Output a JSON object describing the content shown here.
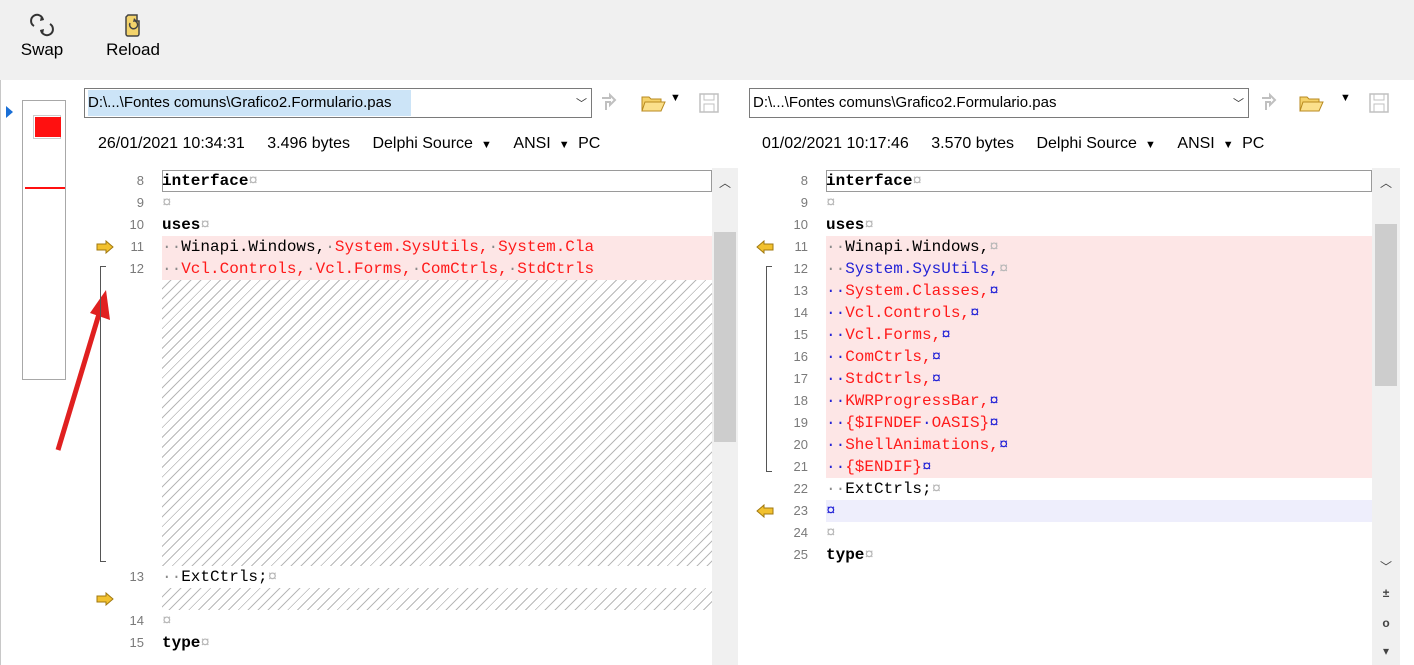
{
  "toolbar": {
    "swap_label": "Swap",
    "reload_label": "Reload"
  },
  "left": {
    "path": "D:\\...\\Fontes comuns\\Grafico2.Formulario.pas",
    "date": "26/01/2021 10:34:31",
    "size": "3.496 bytes",
    "format": "Delphi Source",
    "encoding": "ANSI",
    "lineend": "PC",
    "lines": [
      {
        "n": "8",
        "segs": [
          {
            "t": "interface",
            "c": "kw"
          },
          {
            "t": "¤",
            "c": "pil"
          }
        ]
      },
      {
        "n": "9",
        "segs": [
          {
            "t": "¤",
            "c": "pil"
          }
        ]
      },
      {
        "n": "10",
        "segs": [
          {
            "t": "uses",
            "c": "kw"
          },
          {
            "t": "¤",
            "c": "pil"
          }
        ]
      },
      {
        "n": "11",
        "segs": [
          {
            "t": "··",
            "c": "dots"
          },
          {
            "t": "Winapi.Windows,",
            "c": ""
          },
          {
            "t": "·",
            "c": "dots"
          },
          {
            "t": "System.SysUtils,",
            "c": "red"
          },
          {
            "t": "·",
            "c": "dots"
          },
          {
            "t": "System.Cla",
            "c": "red"
          }
        ]
      },
      {
        "n": "12",
        "segs": [
          {
            "t": "··",
            "c": "dots"
          },
          {
            "t": "Vcl.Controls,",
            "c": "red"
          },
          {
            "t": "·",
            "c": "dots"
          },
          {
            "t": "Vcl.Forms,",
            "c": "red"
          },
          {
            "t": "·",
            "c": "dots"
          },
          {
            "t": "ComCtrls,",
            "c": "red"
          },
          {
            "t": "·",
            "c": "dots"
          },
          {
            "t": "StdCtrls",
            "c": "red"
          }
        ]
      },
      {
        "n": "13",
        "segs": [
          {
            "t": "··",
            "c": "dots"
          },
          {
            "t": "ExtCtrls;",
            "c": ""
          },
          {
            "t": "¤",
            "c": "pil"
          }
        ]
      },
      {
        "n": "14",
        "segs": [
          {
            "t": "¤",
            "c": "pil"
          }
        ]
      },
      {
        "n": "15",
        "segs": [
          {
            "t": "type",
            "c": "kw"
          },
          {
            "t": "¤",
            "c": "pil"
          }
        ]
      }
    ]
  },
  "right": {
    "path": "D:\\...\\Fontes comuns\\Grafico2.Formulario.pas",
    "date": "01/02/2021 10:17:46",
    "size": "3.570 bytes",
    "format": "Delphi Source",
    "encoding": "ANSI",
    "lineend": "PC",
    "lines": [
      {
        "n": "8",
        "segs": [
          {
            "t": "interface",
            "c": "kw"
          },
          {
            "t": "¤",
            "c": "pil"
          }
        ]
      },
      {
        "n": "9",
        "segs": [
          {
            "t": "¤",
            "c": "pil"
          }
        ]
      },
      {
        "n": "10",
        "segs": [
          {
            "t": "uses",
            "c": "kw"
          },
          {
            "t": "¤",
            "c": "pil"
          }
        ]
      },
      {
        "n": "11",
        "segs": [
          {
            "t": "··",
            "c": "dots"
          },
          {
            "t": "Winapi.Windows,",
            "c": ""
          },
          {
            "t": "¤",
            "c": "pil"
          }
        ]
      },
      {
        "n": "12",
        "segs": [
          {
            "t": "··",
            "c": "dots"
          },
          {
            "t": "System.SysUtils,",
            "c": "blue"
          },
          {
            "t": "¤",
            "c": "pil"
          }
        ]
      },
      {
        "n": "13",
        "segs": [
          {
            "t": "··",
            "c": "blue"
          },
          {
            "t": "System.Classes,",
            "c": "red"
          },
          {
            "t": "¤",
            "c": "blue"
          }
        ]
      },
      {
        "n": "14",
        "segs": [
          {
            "t": "··",
            "c": "blue"
          },
          {
            "t": "Vcl.Controls,",
            "c": "red"
          },
          {
            "t": "¤",
            "c": "blue"
          }
        ]
      },
      {
        "n": "15",
        "segs": [
          {
            "t": "··",
            "c": "blue"
          },
          {
            "t": "Vcl.Forms,",
            "c": "red"
          },
          {
            "t": "¤",
            "c": "blue"
          }
        ]
      },
      {
        "n": "16",
        "segs": [
          {
            "t": "··",
            "c": "blue"
          },
          {
            "t": "ComCtrls,",
            "c": "red"
          },
          {
            "t": "¤",
            "c": "blue"
          }
        ]
      },
      {
        "n": "17",
        "segs": [
          {
            "t": "··",
            "c": "blue"
          },
          {
            "t": "StdCtrls,",
            "c": "red"
          },
          {
            "t": "¤",
            "c": "blue"
          }
        ]
      },
      {
        "n": "18",
        "segs": [
          {
            "t": "··",
            "c": "blue"
          },
          {
            "t": "KWRProgressBar,",
            "c": "red"
          },
          {
            "t": "¤",
            "c": "blue"
          }
        ]
      },
      {
        "n": "19",
        "segs": [
          {
            "t": "··",
            "c": "blue"
          },
          {
            "t": "{$IFNDEF",
            "c": "red"
          },
          {
            "t": "·",
            "c": "blue"
          },
          {
            "t": "OASIS}",
            "c": "red"
          },
          {
            "t": "¤",
            "c": "blue"
          }
        ]
      },
      {
        "n": "20",
        "segs": [
          {
            "t": "··",
            "c": "blue"
          },
          {
            "t": "ShellAnimations,",
            "c": "red"
          },
          {
            "t": "¤",
            "c": "blue"
          }
        ]
      },
      {
        "n": "21",
        "segs": [
          {
            "t": "··",
            "c": "blue"
          },
          {
            "t": "{$ENDIF}",
            "c": "red"
          },
          {
            "t": "¤",
            "c": "blue"
          }
        ]
      },
      {
        "n": "22",
        "segs": [
          {
            "t": "··",
            "c": "dots"
          },
          {
            "t": "ExtCtrls;",
            "c": ""
          },
          {
            "t": "¤",
            "c": "pil"
          }
        ]
      },
      {
        "n": "23",
        "segs": [
          {
            "t": "¤",
            "c": "blue"
          }
        ]
      },
      {
        "n": "24",
        "segs": [
          {
            "t": "¤",
            "c": "pil"
          }
        ]
      },
      {
        "n": "25",
        "segs": [
          {
            "t": "type",
            "c": "kw"
          },
          {
            "t": "¤",
            "c": "pil"
          }
        ]
      }
    ]
  },
  "colors": {
    "changed_bg": "#fde6e6",
    "inserted_bg": "#eeeefc",
    "annotation_arrow": "#e02020",
    "diff_marker": "#f2c12e"
  }
}
